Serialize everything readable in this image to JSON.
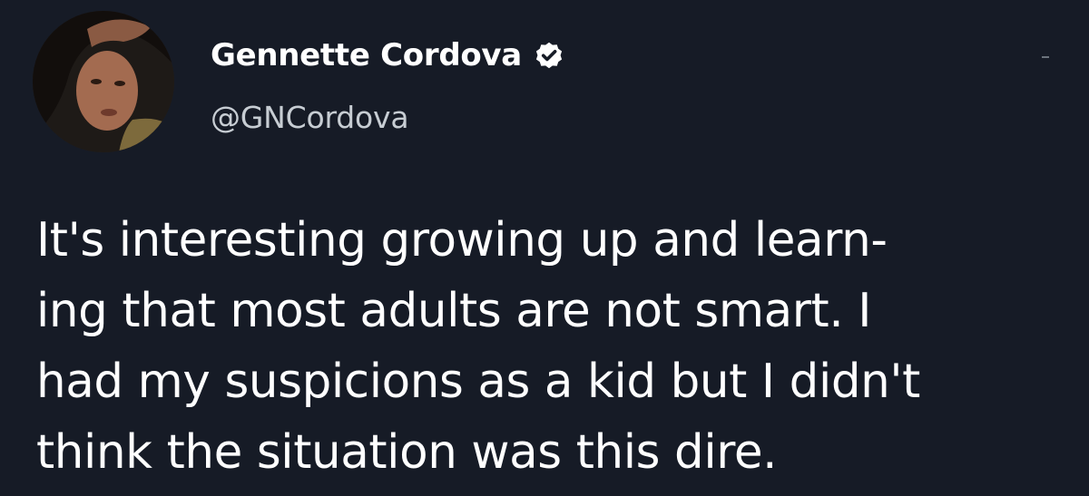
{
  "author": {
    "display_name": "Gennette Cordova",
    "handle": "@GNCordova",
    "verified": true,
    "avatar_icon": "profile-photo",
    "verified_icon": "verified-badge-icon"
  },
  "tweet": {
    "lines": [
      "It's interesting growing up and learn-",
      "ing that most adults are not smart. I",
      "had my suspicions as a kid but I didn't",
      "think the situation was this dire."
    ]
  },
  "colors": {
    "background": "#161b26",
    "text": "#ffffff",
    "handle": "#c7cdd3"
  }
}
